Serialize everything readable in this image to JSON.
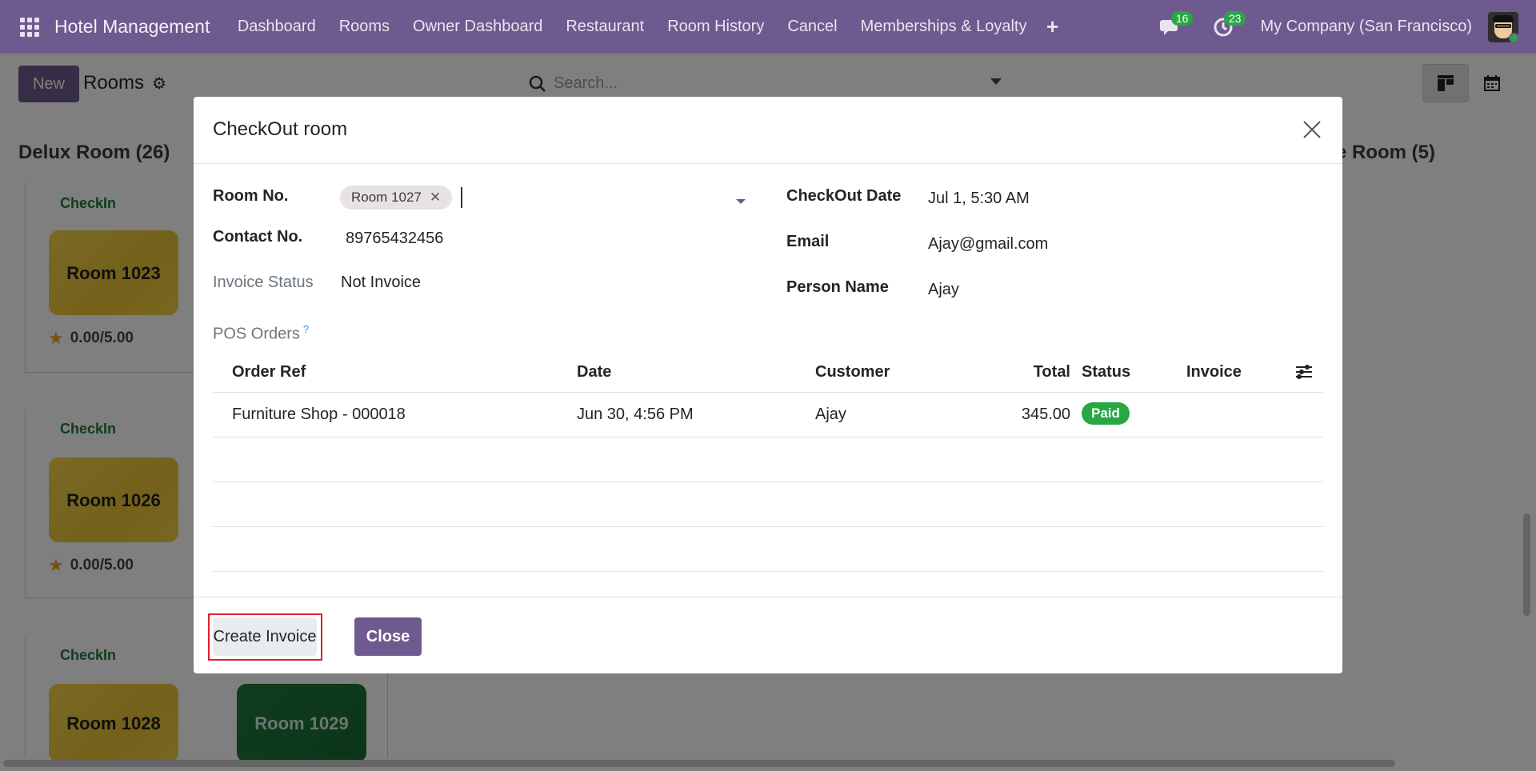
{
  "navbar": {
    "brand": "Hotel Management",
    "menu": [
      "Dashboard",
      "Rooms",
      "Owner Dashboard",
      "Restaurant",
      "Room History",
      "Cancel",
      "Memberships & Loyalty"
    ],
    "plus": "+",
    "messages_count": "16",
    "activities_count": "23",
    "company": "My Company (San Francisco)"
  },
  "control_panel": {
    "new_label": "New",
    "breadcrumb": "Rooms",
    "search_placeholder": "Search..."
  },
  "kanban": {
    "columns": [
      {
        "title": "Delux Room (26)"
      },
      {
        "title": "e Room (5)"
      }
    ],
    "cards": [
      {
        "status": "CheckIn",
        "rooms": [
          "Room 1023"
        ],
        "rating": "0.00/5.00"
      },
      {
        "status": "CheckIn",
        "rooms": [
          "Room 1026"
        ],
        "rating": "0.00/5.00"
      },
      {
        "status": "CheckIn",
        "rooms": [
          "Room 1028",
          "Room 1029"
        ]
      }
    ]
  },
  "modal": {
    "title": "CheckOut room",
    "fields": {
      "room_no_label": "Room No.",
      "room_no_value": "Room 1027",
      "contact_label": "Contact No.",
      "contact_value": "89765432456",
      "invoice_status_label": "Invoice Status",
      "invoice_status_value": "Not Invoice",
      "checkout_date_label": "CheckOut Date",
      "checkout_date_value": "Jul 1, 5:30 AM",
      "email_label": "Email",
      "email_value": "Ajay@gmail.com",
      "person_label": "Person Name",
      "person_value": "Ajay"
    },
    "pos_orders": {
      "label": "POS Orders",
      "help": "?",
      "columns": [
        "Order Ref",
        "Date",
        "Customer",
        "Total",
        "Status",
        "Invoice"
      ],
      "rows": [
        {
          "order_ref": "Furniture Shop - 000018",
          "date": "Jun 30, 4:56 PM",
          "customer": "Ajay",
          "total": "345.00",
          "status": "Paid",
          "invoice": ""
        }
      ]
    },
    "buttons": {
      "create_invoice": "Create Invoice",
      "close": "Close"
    }
  },
  "colors": {
    "brand": "#6f5a8f",
    "paid": "#28a745",
    "highlight": "#e0202a"
  }
}
